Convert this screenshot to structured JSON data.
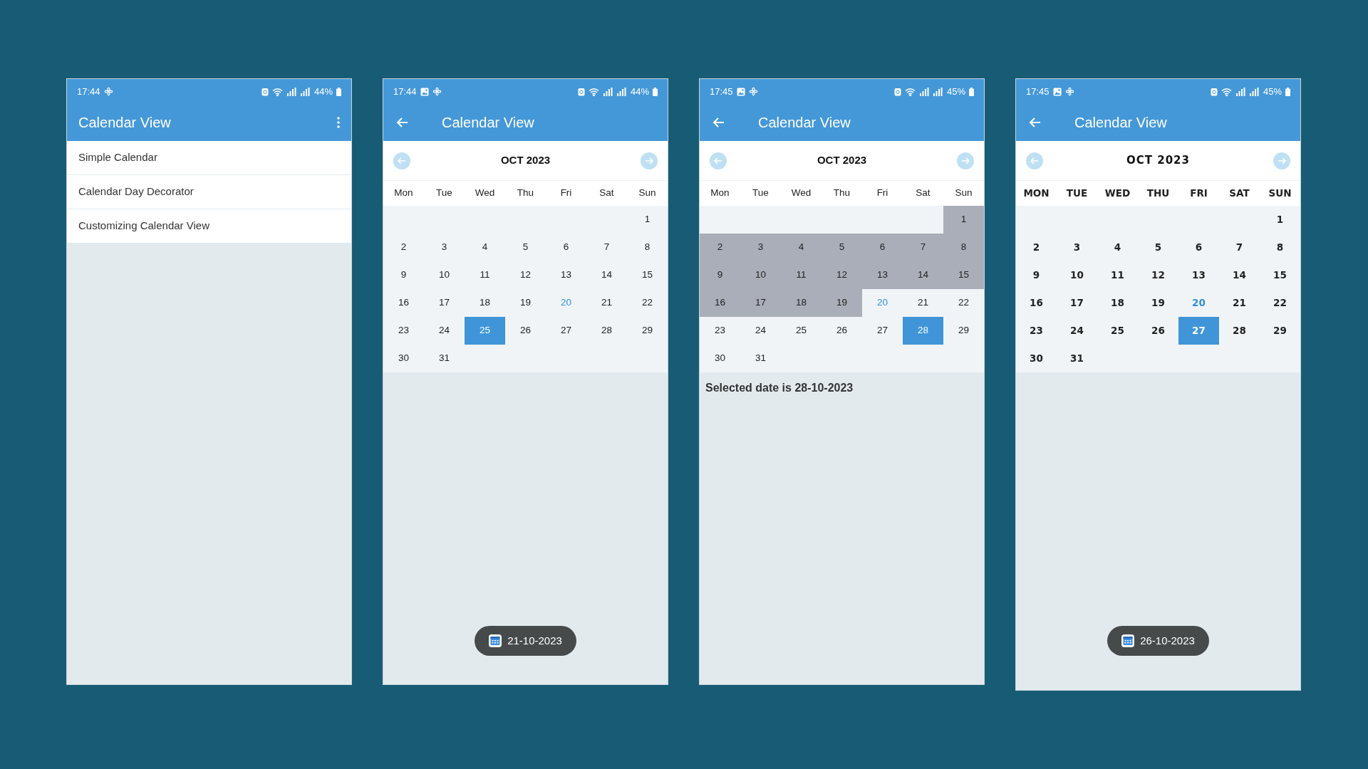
{
  "phones": [
    {
      "kind": "menu",
      "status_bar": {
        "time": "17:44",
        "image_notification": false,
        "battery": "44%"
      },
      "app_bar": {
        "title": "Calendar View",
        "back": false,
        "overflow_menu": true
      },
      "menu_items": [
        {
          "label": "Simple Calendar"
        },
        {
          "label": "Calendar Day Decorator"
        },
        {
          "label": "Customizing Calendar View"
        }
      ]
    },
    {
      "kind": "calendar",
      "status_bar": {
        "time": "17:44",
        "image_notification": true,
        "battery": "44%"
      },
      "app_bar": {
        "title": "Calendar View",
        "back": true,
        "overflow_menu": false
      },
      "calendar": {
        "month": "OCT 2023",
        "weekdays": [
          "Mon",
          "Tue",
          "Wed",
          "Thu",
          "Fri",
          "Sat",
          "Sun"
        ],
        "weeks": [
          [
            {
              "label": "1",
              "selected": false,
              "today": false,
              "in_range": false
            }
          ],
          [
            {
              "label": "2",
              "selected": false,
              "today": false,
              "in_range": false
            },
            {
              "label": "3",
              "selected": false,
              "today": false,
              "in_range": false
            },
            {
              "label": "4",
              "selected": false,
              "today": false,
              "in_range": false
            },
            {
              "label": "5",
              "selected": false,
              "today": false,
              "in_range": false
            },
            {
              "label": "6",
              "selected": false,
              "today": false,
              "in_range": false
            },
            {
              "label": "7",
              "selected": false,
              "today": false,
              "in_range": false
            },
            {
              "label": "8",
              "selected": false,
              "today": false,
              "in_range": false
            }
          ],
          [
            {
              "label": "9",
              "selected": false,
              "today": false,
              "in_range": false
            },
            {
              "label": "10",
              "selected": false,
              "today": false,
              "in_range": false
            },
            {
              "label": "11",
              "selected": false,
              "today": false,
              "in_range": false
            },
            {
              "label": "12",
              "selected": false,
              "today": false,
              "in_range": false
            },
            {
              "label": "13",
              "selected": false,
              "today": false,
              "in_range": false
            },
            {
              "label": "14",
              "selected": false,
              "today": false,
              "in_range": false
            },
            {
              "label": "15",
              "selected": false,
              "today": false,
              "in_range": false
            }
          ],
          [
            {
              "label": "16",
              "selected": false,
              "today": false,
              "in_range": false
            },
            {
              "label": "17",
              "selected": false,
              "today": false,
              "in_range": false
            },
            {
              "label": "18",
              "selected": false,
              "today": false,
              "in_range": false
            },
            {
              "label": "19",
              "selected": false,
              "today": false,
              "in_range": false
            },
            {
              "label": "20",
              "selected": false,
              "today": true,
              "in_range": false
            },
            {
              "label": "21",
              "selected": false,
              "today": false,
              "in_range": false
            },
            {
              "label": "22",
              "selected": false,
              "today": false,
              "in_range": false
            }
          ],
          [
            {
              "label": "23",
              "selected": false,
              "today": false,
              "in_range": false
            },
            {
              "label": "24",
              "selected": false,
              "today": false,
              "in_range": false
            },
            {
              "label": "25",
              "selected": true,
              "today": false,
              "in_range": false
            },
            {
              "label": "26",
              "selected": false,
              "today": false,
              "in_range": false
            },
            {
              "label": "27",
              "selected": false,
              "today": false,
              "in_range": false
            },
            {
              "label": "28",
              "selected": false,
              "today": false,
              "in_range": false
            },
            {
              "label": "29",
              "selected": false,
              "today": false,
              "in_range": false
            }
          ],
          [
            {
              "label": "30",
              "selected": false,
              "today": false,
              "in_range": false
            },
            {
              "label": "31",
              "selected": false,
              "today": false,
              "in_range": false
            }
          ]
        ]
      },
      "toast": "21-10-2023"
    },
    {
      "kind": "calendar",
      "status_bar": {
        "time": "17:45",
        "image_notification": true,
        "battery": "45%"
      },
      "app_bar": {
        "title": "Calendar View",
        "back": true,
        "overflow_menu": false
      },
      "calendar": {
        "month": "OCT 2023",
        "weekdays": [
          "Mon",
          "Tue",
          "Wed",
          "Thu",
          "Fri",
          "Sat",
          "Sun"
        ],
        "weeks": [
          [
            {
              "label": "1",
              "selected": false,
              "today": false,
              "in_range": true
            }
          ],
          [
            {
              "label": "2",
              "selected": false,
              "today": false,
              "in_range": true
            },
            {
              "label": "3",
              "selected": false,
              "today": false,
              "in_range": true
            },
            {
              "label": "4",
              "selected": false,
              "today": false,
              "in_range": true
            },
            {
              "label": "5",
              "selected": false,
              "today": false,
              "in_range": true
            },
            {
              "label": "6",
              "selected": false,
              "today": false,
              "in_range": true
            },
            {
              "label": "7",
              "selected": false,
              "today": false,
              "in_range": true
            },
            {
              "label": "8",
              "selected": false,
              "today": false,
              "in_range": true
            }
          ],
          [
            {
              "label": "9",
              "selected": false,
              "today": false,
              "in_range": true
            },
            {
              "label": "10",
              "selected": false,
              "today": false,
              "in_range": true
            },
            {
              "label": "11",
              "selected": false,
              "today": false,
              "in_range": true
            },
            {
              "label": "12",
              "selected": false,
              "today": false,
              "in_range": true
            },
            {
              "label": "13",
              "selected": false,
              "today": false,
              "in_range": true
            },
            {
              "label": "14",
              "selected": false,
              "today": false,
              "in_range": true
            },
            {
              "label": "15",
              "selected": false,
              "today": false,
              "in_range": true
            }
          ],
          [
            {
              "label": "16",
              "selected": false,
              "today": false,
              "in_range": true
            },
            {
              "label": "17",
              "selected": false,
              "today": false,
              "in_range": true
            },
            {
              "label": "18",
              "selected": false,
              "today": false,
              "in_range": true
            },
            {
              "label": "19",
              "selected": false,
              "today": false,
              "in_range": true
            },
            {
              "label": "20",
              "selected": false,
              "today": true,
              "in_range": false
            },
            {
              "label": "21",
              "selected": false,
              "today": false,
              "in_range": false
            },
            {
              "label": "22",
              "selected": false,
              "today": false,
              "in_range": false
            }
          ],
          [
            {
              "label": "23",
              "selected": false,
              "today": false,
              "in_range": false
            },
            {
              "label": "24",
              "selected": false,
              "today": false,
              "in_range": false
            },
            {
              "label": "25",
              "selected": false,
              "today": false,
              "in_range": false
            },
            {
              "label": "26",
              "selected": false,
              "today": false,
              "in_range": false
            },
            {
              "label": "27",
              "selected": false,
              "today": false,
              "in_range": false
            },
            {
              "label": "28",
              "selected": true,
              "today": false,
              "in_range": false
            },
            {
              "label": "29",
              "selected": false,
              "today": false,
              "in_range": false
            }
          ],
          [
            {
              "label": "30",
              "selected": false,
              "today": false,
              "in_range": false
            },
            {
              "label": "31",
              "selected": false,
              "today": false,
              "in_range": false
            }
          ]
        ]
      },
      "caption": "Selected date is 28-10-2023"
    },
    {
      "kind": "custom_calendar",
      "status_bar": {
        "time": "17:45",
        "image_notification": true,
        "battery": "45%"
      },
      "app_bar": {
        "title": "Calendar View",
        "back": true,
        "overflow_menu": false
      },
      "calendar": {
        "month": "OCT 2023",
        "weekdays": [
          "MON",
          "TUE",
          "WED",
          "THU",
          "FRI",
          "SAT",
          "SUN"
        ],
        "weeks": [
          [
            {
              "label": "1",
              "selected": false,
              "today": false,
              "in_range": false
            }
          ],
          [
            {
              "label": "2",
              "selected": false,
              "today": false,
              "in_range": false
            },
            {
              "label": "3",
              "selected": false,
              "today": false,
              "in_range": false
            },
            {
              "label": "4",
              "selected": false,
              "today": false,
              "in_range": false
            },
            {
              "label": "5",
              "selected": false,
              "today": false,
              "in_range": false
            },
            {
              "label": "6",
              "selected": false,
              "today": false,
              "in_range": false
            },
            {
              "label": "7",
              "selected": false,
              "today": false,
              "in_range": false
            },
            {
              "label": "8",
              "selected": false,
              "today": false,
              "in_range": false
            }
          ],
          [
            {
              "label": "9",
              "selected": false,
              "today": false,
              "in_range": false
            },
            {
              "label": "10",
              "selected": false,
              "today": false,
              "in_range": false
            },
            {
              "label": "11",
              "selected": false,
              "today": false,
              "in_range": false
            },
            {
              "label": "12",
              "selected": false,
              "today": false,
              "in_range": false
            },
            {
              "label": "13",
              "selected": false,
              "today": false,
              "in_range": false
            },
            {
              "label": "14",
              "selected": false,
              "today": false,
              "in_range": false
            },
            {
              "label": "15",
              "selected": false,
              "today": false,
              "in_range": false
            }
          ],
          [
            {
              "label": "16",
              "selected": false,
              "today": false,
              "in_range": false
            },
            {
              "label": "17",
              "selected": false,
              "today": false,
              "in_range": false
            },
            {
              "label": "18",
              "selected": false,
              "today": false,
              "in_range": false
            },
            {
              "label": "19",
              "selected": false,
              "today": false,
              "in_range": false
            },
            {
              "label": "20",
              "selected": false,
              "today": true,
              "in_range": false
            },
            {
              "label": "21",
              "selected": false,
              "today": false,
              "in_range": false
            },
            {
              "label": "22",
              "selected": false,
              "today": false,
              "in_range": false
            }
          ],
          [
            {
              "label": "23",
              "selected": false,
              "today": false,
              "in_range": false
            },
            {
              "label": "24",
              "selected": false,
              "today": false,
              "in_range": false
            },
            {
              "label": "25",
              "selected": false,
              "today": false,
              "in_range": false
            },
            {
              "label": "26",
              "selected": false,
              "today": false,
              "in_range": false
            },
            {
              "label": "27",
              "selected": true,
              "today": false,
              "in_range": false
            },
            {
              "label": "28",
              "selected": false,
              "today": false,
              "in_range": false
            },
            {
              "label": "29",
              "selected": false,
              "today": false,
              "in_range": false
            }
          ],
          [
            {
              "label": "30",
              "selected": false,
              "today": false,
              "in_range": false
            },
            {
              "label": "31",
              "selected": false,
              "today": false,
              "in_range": false
            }
          ]
        ]
      },
      "toast": "26-10-2023"
    }
  ]
}
